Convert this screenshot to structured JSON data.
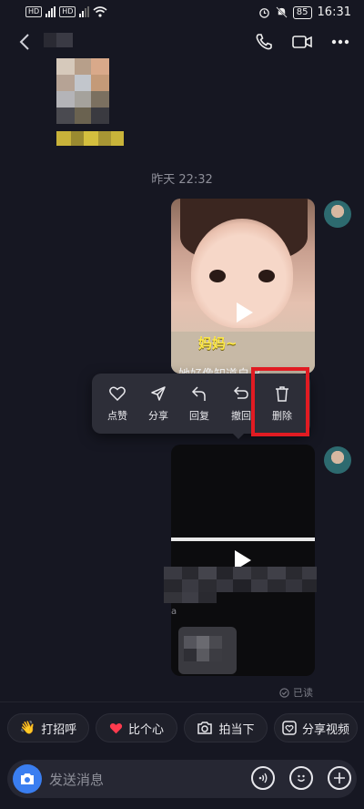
{
  "status": {
    "signal_hd_1": "HD",
    "signal_hd_2": "HD",
    "battery": "85",
    "time": "16:31"
  },
  "chat": {
    "timestamp": "昨天 22:32",
    "video1": {
      "caption_big": "妈妈~",
      "caption_sub": "她好像知道自己..."
    },
    "video2_partial_text": "a",
    "read_status": "已读"
  },
  "context_menu": {
    "items": [
      {
        "label": "点赞",
        "icon": "heart-icon"
      },
      {
        "label": "分享",
        "icon": "send-icon"
      },
      {
        "label": "回复",
        "icon": "reply-icon"
      },
      {
        "label": "撤回",
        "icon": "undo-icon"
      },
      {
        "label": "删除",
        "icon": "trash-icon"
      }
    ],
    "highlight_color": "#e11b22"
  },
  "quick_actions": [
    {
      "label": "打招呼",
      "icon": "wave-hand-icon"
    },
    {
      "label": "比个心",
      "icon": "heart-filled-icon"
    },
    {
      "label": "拍当下",
      "icon": "camera-icon"
    },
    {
      "label": "分享视频",
      "icon": "share-video-icon"
    }
  ],
  "input": {
    "placeholder": "发送消息"
  },
  "colors": {
    "background": "#161722",
    "accent": "#3a7ef0"
  }
}
